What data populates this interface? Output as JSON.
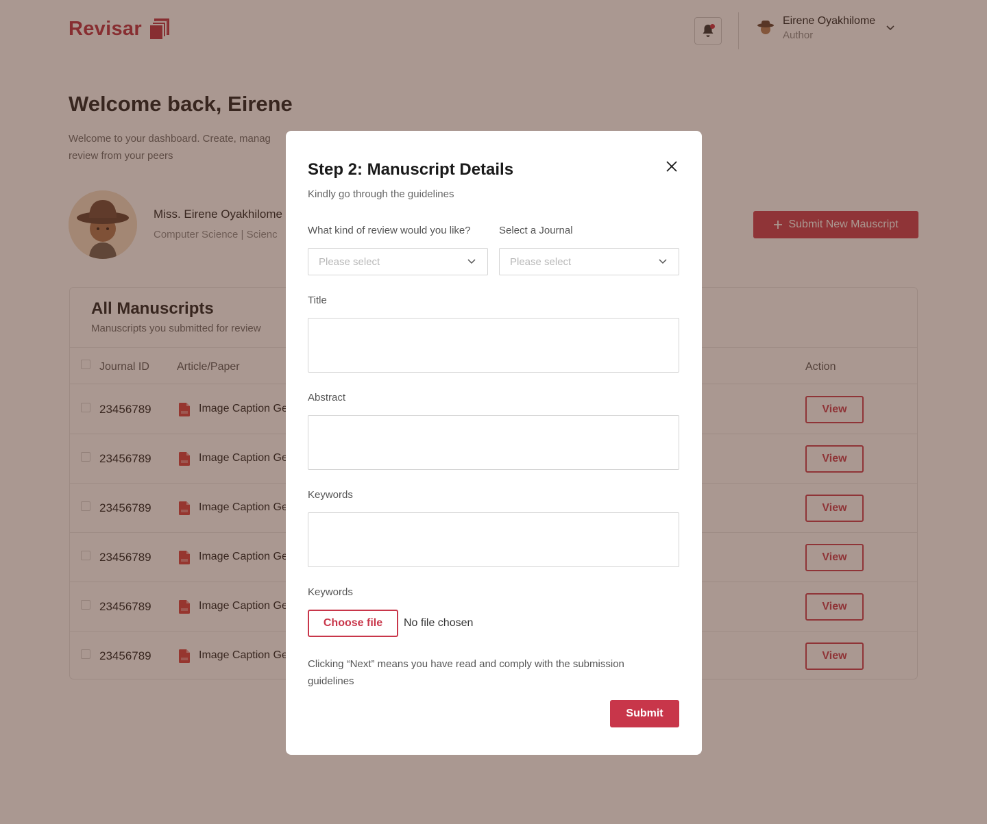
{
  "brand": {
    "name": "Revisar",
    "accent": "#c8364a"
  },
  "header": {
    "user_name": "Eirene Oyakhilome",
    "user_role": "Author",
    "icons": {
      "notification": "bell-icon",
      "dropdown": "chevron-down-icon"
    }
  },
  "welcome": {
    "title": "Welcome back, Eirene",
    "subtitle": "Welcome to your dashboard. Create, manag review from your peers"
  },
  "profile": {
    "name": "Miss. Eirene Oyakhilome",
    "dept": "Computer Science | Scienc"
  },
  "submit_new_label": "Submit New Mauscript",
  "manuscripts": {
    "title": "All Manuscripts",
    "subtitle": "Manuscripts you submitted for review",
    "columns": {
      "journal_id": "Journal  ID",
      "article": "Article/Paper",
      "action": "Action"
    },
    "rows": [
      {
        "id": "23456789",
        "article": "Image Caption Ge",
        "action": "View"
      },
      {
        "id": "23456789",
        "article": "Image Caption Ge",
        "action": "View"
      },
      {
        "id": "23456789",
        "article": "Image Caption Ge",
        "action": "View"
      },
      {
        "id": "23456789",
        "article": "Image Caption Ge",
        "action": "View"
      },
      {
        "id": "23456789",
        "article": "Image Caption Ge",
        "action": "View"
      },
      {
        "id": "23456789",
        "article": "Image Caption Ge",
        "action": "View"
      }
    ]
  },
  "modal": {
    "title": "Step 2: Manuscript Details",
    "subtitle": "Kindly go through the guidelines",
    "review_label": "What kind of review would you like?",
    "review_placeholder": "Please select",
    "journal_label": "Select a Journal",
    "journal_placeholder": "Please select",
    "title_label": "Title",
    "title_value": "",
    "abstract_label": "Abstract",
    "abstract_value": "",
    "keywords_label": "Keywords",
    "keywords_value": "",
    "file_label": "Keywords",
    "choose_file": "Choose file",
    "no_file": "No file chosen",
    "notice": "Clicking “Next” means you have read and comply with the submission guidelines",
    "submit": "Submit"
  }
}
